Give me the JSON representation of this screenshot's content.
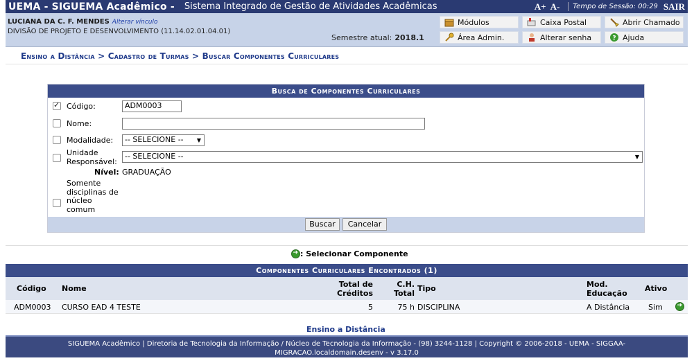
{
  "header": {
    "brand": "UEMA - SIGUEMA Acadêmico -",
    "system": "Sistema Integrado de Gestão de Atividades Acadêmicas",
    "font_increase": "A+",
    "font_decrease": "A-",
    "session_label": "Tempo de Sessão: 00:29",
    "logout": "SAIR"
  },
  "user": {
    "name": "LUCIANA DA C. F. MENDES",
    "change_link": "Alterar vínculo",
    "department": "DIVISÃO DE PROJETO E DESENVOLVIMENTO (11.14.02.01.04.01)",
    "semester_label": "Semestre atual:",
    "semester_value": "2018.1"
  },
  "menu": {
    "modulos": "Módulos",
    "caixa_postal": "Caixa Postal",
    "abrir_chamado": "Abrir Chamado",
    "area_admin": "Área Admin.",
    "alterar_senha": "Alterar senha",
    "ajuda": "Ajuda"
  },
  "breadcrumb": {
    "part1": "Ensino a Distância",
    "part2": "Cadastro de Turmas",
    "part3": "Buscar Componentes Curriculares",
    "sep": ">"
  },
  "search_form": {
    "caption": "Busca de Componentes Curriculares",
    "codigo_label": "Código:",
    "codigo_value": "ADM0003",
    "nome_label": "Nome:",
    "nome_value": "",
    "modalidade_label": "Modalidade:",
    "modalidade_value": "-- SELECIONE --",
    "unidade_label_1": "Unidade",
    "unidade_label_2": "Responsável:",
    "unidade_value": "-- SELECIONE --",
    "nivel_label": "Nível:",
    "nivel_value": "GRADUAÇÃO",
    "nucleo_label_1": "Somente",
    "nucleo_label_2": "disciplinas de",
    "nucleo_label_3": "núcleo",
    "nucleo_label_4": "comum",
    "search_button": "Buscar",
    "cancel_button": "Cancelar"
  },
  "legend": {
    "text": ": Selecionar Componente"
  },
  "results": {
    "caption": "Componentes Curriculares Encontrados (1)",
    "headers": {
      "codigo": "Código",
      "nome": "Nome",
      "creditos_1": "Total de",
      "creditos_2": "Créditos",
      "ch_1": "C.H.",
      "ch_2": "Total",
      "tipo": "Tipo",
      "mod_1": "Mod.",
      "mod_2": "Educação",
      "ativo": "Ativo"
    },
    "rows": [
      {
        "codigo": "ADM0003",
        "nome": "CURSO EAD 4 TESTE",
        "creditos": "5",
        "ch": "75 h",
        "tipo": "DISCIPLINA",
        "mod": "A Distância",
        "ativo": "Sim"
      }
    ]
  },
  "footer": {
    "link": "Ensino a Distância",
    "line1": "SIGUEMA Acadêmico | Diretoria de Tecnologia da Informação / Núcleo de Tecnologia da Informação - (98) 3244-1128 | Copyright © 2006-2018 - UEMA - SIGGAA-",
    "line2": "MIGRACAO.localdomain.desenv - v 3.17.0"
  }
}
